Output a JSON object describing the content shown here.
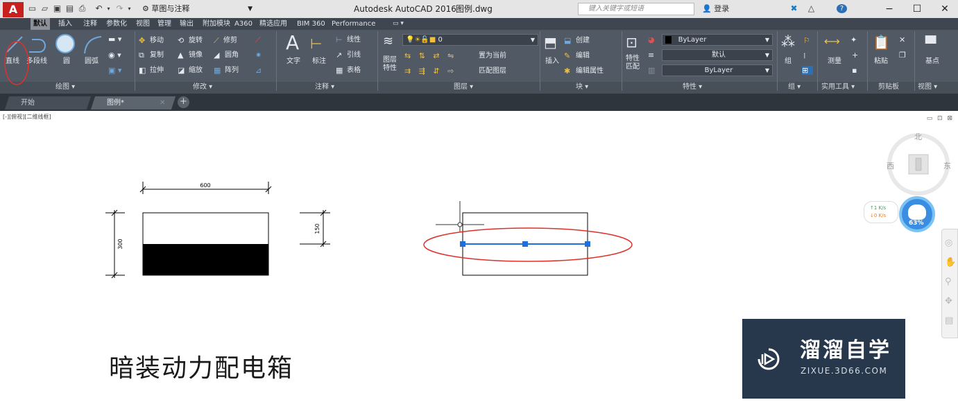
{
  "titlebar": {
    "logo": "A",
    "workspace": "草图与注释",
    "title": "Autodesk AutoCAD 2016",
    "filename": "图例.dwg",
    "search_placeholder": "键入关键字或短语",
    "login": "登录",
    "minimize": "−",
    "maximize": "☐",
    "close": "✕"
  },
  "ribbon_tabs": [
    "默认",
    "插入",
    "注释",
    "参数化",
    "视图",
    "管理",
    "输出",
    "附加模块",
    "A360",
    "精选应用",
    "BIM 360",
    "Performance"
  ],
  "ribbon": {
    "draw": {
      "line": "直线",
      "polyline": "多段线",
      "circle": "圆",
      "arc": "圆弧",
      "title": "绘图 ▾"
    },
    "modify": {
      "move": "移动",
      "rotate": "旋转",
      "trim": "修剪",
      "copy": "复制",
      "mirror": "镜像",
      "fillet": "圆角",
      "stretch": "拉伸",
      "scale": "缩放",
      "array": "阵列",
      "title": "修改 ▾"
    },
    "annotation": {
      "text": "文字",
      "dimension": "标注",
      "linear": "线性",
      "leader": "引线",
      "table": "表格",
      "title": "注释 ▾"
    },
    "layers": {
      "layer_properties": "图层\n特性",
      "current_layer": "0",
      "set_current": "置为当前",
      "match_layer": "匹配图层",
      "title": "图层 ▾"
    },
    "block": {
      "insert": "插入",
      "create": "创建",
      "edit": "编辑",
      "edit_attributes": "编辑属性",
      "title": "块 ▾"
    },
    "properties": {
      "match": "特性\n匹配",
      "color": "ByLayer",
      "linetype": "默认",
      "lineweight": "ByLayer",
      "title": "特性 ▾"
    },
    "groups": {
      "group": "组",
      "title": "组 ▾"
    },
    "utilities": {
      "measure": "测量",
      "title": "实用工具 ▾"
    },
    "clipboard": {
      "paste": "粘贴",
      "title": "剪贴板"
    },
    "view": {
      "base": "基点",
      "title": "视图 ▾"
    }
  },
  "file_tabs": {
    "start": "开始",
    "drawing": "图例*"
  },
  "viewport": {
    "label": "[-][俯视][二维线框]"
  },
  "viewcube": {
    "north": "北",
    "west": "西",
    "east": "东"
  },
  "net_widget": {
    "up": "↑1  K/s",
    "down": "↓0  K/s",
    "cpu": "63%"
  },
  "drawing": {
    "dim_width": "600",
    "dim_height_left": "300",
    "dim_height_right": "150",
    "caption": "暗装动力配电箱"
  },
  "watermark": {
    "name": "溜溜自学",
    "url": "ZIXUE.3D66.COM"
  },
  "colors": {
    "ribbon_bg": "#505964",
    "tabs_bg": "#3f4650",
    "highlight_red": "#e0302a",
    "selection_blue": "#1e6fd9",
    "watermark_bg": "#27374c"
  }
}
